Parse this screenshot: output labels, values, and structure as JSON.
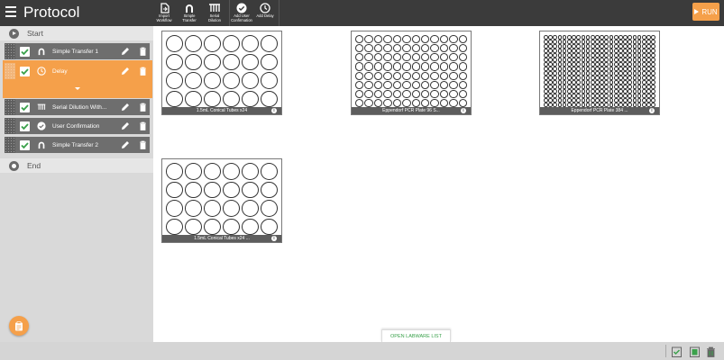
{
  "header": {
    "title": "Protocol",
    "toolbar": [
      {
        "label": "Import\nWorkflow",
        "icon": "import-icon"
      },
      {
        "label": "Simple\nTransfer",
        "icon": "pipette-icon"
      },
      {
        "label": "Serial\nDilution",
        "icon": "multichannel-icon"
      },
      {
        "label": "Add User\nConfirmation",
        "icon": "check-circle-icon"
      },
      {
        "label": "Add Delay",
        "icon": "clock-icon"
      }
    ],
    "run_label": "RUN"
  },
  "sidebar": {
    "start_label": "Start",
    "end_label": "End",
    "steps": [
      {
        "label": "Simple Transfer 1",
        "icon": "pipette-icon",
        "checked": true,
        "active": false
      },
      {
        "label": "Delay",
        "icon": "clock-icon",
        "checked": true,
        "active": true
      },
      {
        "label": "Serial Dilution With...",
        "icon": "multichannel-icon",
        "checked": true,
        "active": false
      },
      {
        "label": "User Confirmation",
        "icon": "check-circle-icon",
        "checked": true,
        "active": false
      },
      {
        "label": "Simple Transfer 2",
        "icon": "pipette-icon",
        "checked": true,
        "active": false
      }
    ]
  },
  "workspace": {
    "labware": [
      {
        "caption": "1.5mL Conical Tubes x24",
        "rows": 4,
        "cols": 6
      },
      {
        "caption": "Eppendorf PCR Plate 96 S...",
        "rows": 8,
        "cols": 12
      },
      {
        "caption": "Eppendorf PCR Plate 384 ...",
        "rows": 16,
        "cols": 24
      },
      {
        "caption": "1.5mL Conical Tubes x24 ...",
        "rows": 4,
        "cols": 6
      }
    ],
    "open_labware_list": "OPEN LABWARE LIST"
  },
  "colors": {
    "accent": "#f5a04a",
    "topbar": "#3b3b3b",
    "step_bg": "#6e6e6e",
    "check_green": "#3aa14b"
  }
}
